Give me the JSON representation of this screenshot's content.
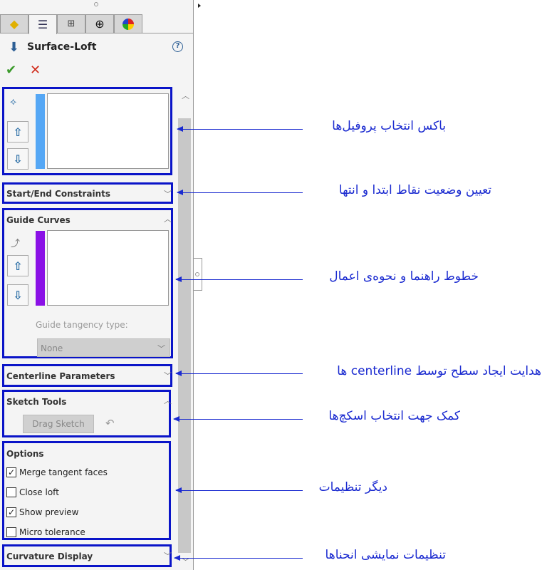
{
  "panel": {
    "tabs": [
      {
        "icon": "feature-manager-icon"
      },
      {
        "icon": "property-manager-icon",
        "active": true
      },
      {
        "icon": "configuration-manager-icon"
      },
      {
        "icon": "dimxpert-icon"
      },
      {
        "icon": "display-manager-icon"
      }
    ],
    "title": "Surface-Loft",
    "profiles": {
      "color": "#55a7f5"
    },
    "start_end": "Start/End Constraints",
    "guide_curves": {
      "title": "Guide Curves",
      "color": "#8a10e6",
      "tangency_label": "Guide tangency type:",
      "tangency_value": "None"
    },
    "centerline": "Centerline Parameters",
    "sketch_tools": {
      "title": "Sketch Tools",
      "drag_label": "Drag Sketch"
    },
    "options": {
      "title": "Options",
      "items": [
        {
          "label": "Merge tangent faces",
          "checked": true
        },
        {
          "label": "Close loft",
          "checked": false
        },
        {
          "label": "Show preview",
          "checked": true
        },
        {
          "label": "Micro tolerance",
          "checked": false
        }
      ]
    },
    "curvature": "Curvature Display"
  },
  "annotations": [
    "باکس انتخاب پروفیل‌ها",
    "تعیین وضعیت نقاط ابتدا و انتها",
    "خطوط راهنما و نحوه‌ی اعمال",
    "هدایت ایجاد سطح توسط centerline ها",
    "کمک جهت انتخاب اسکچ‌ها",
    "دیگر تنظیمات",
    "تنظیمات نمایشی انحناها"
  ],
  "colors": {
    "highlight": "#0a14c8",
    "annotation": "#1a2ad0"
  }
}
